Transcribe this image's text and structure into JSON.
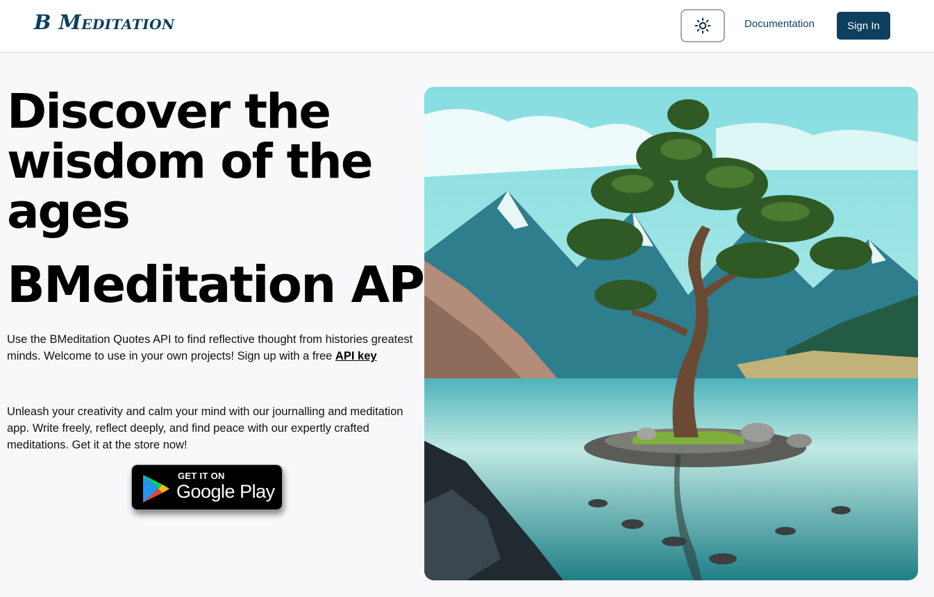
{
  "header": {
    "logo_text": "B Meditation",
    "theme_toggle_icon": "sun-icon",
    "documentation_label": "Documentation",
    "signin_label": "Sign In"
  },
  "hero": {
    "headline": "Discover the wisdom of the ages",
    "subheadline": "BMeditation API",
    "paragraph1_text": "Use the BMeditation Quotes API to find reflective thought from histories greatest minds. Welcome to use in your own projects! Sign up with a free ",
    "api_key_link": "API key",
    "paragraph2": "Unleash your creativity and calm your mind with our journalling and meditation app. Write freely, reflect deeply, and find peace with our expertly crafted meditations. Get it at the store now!",
    "store_badge": {
      "top_text": "GET IT ON",
      "main_text": "Google Play",
      "icon": "google-play-icon"
    },
    "image_icon": "landscape-tree-illustration"
  },
  "colors": {
    "brand": "#0d3f5e",
    "background": "#f8f8fb",
    "header_bg": "#ffffff"
  }
}
